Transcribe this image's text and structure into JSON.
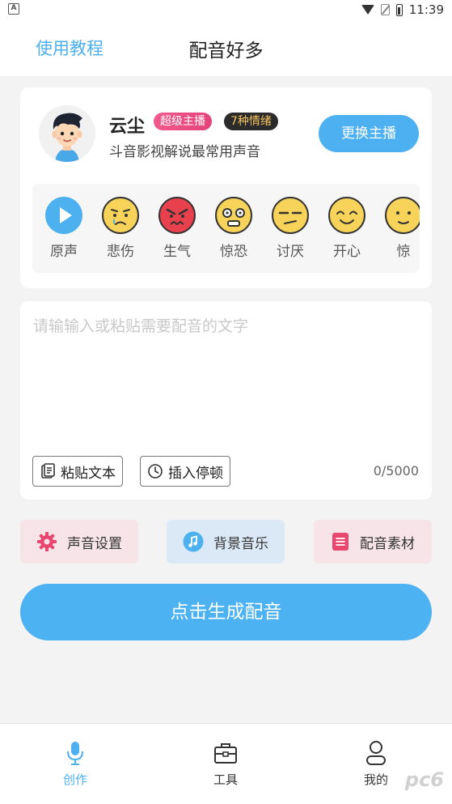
{
  "status_bar": {
    "time": "11:39",
    "left_icon": "a-icon"
  },
  "header": {
    "tutorial_link": "使用教程",
    "title": "配音好多"
  },
  "anchor": {
    "name": "云尘",
    "badge_level": "超级主播",
    "badge_emotions": "7种情绪",
    "description": "斗音影视解说最常用声音",
    "change_button": "更换主播"
  },
  "emotions": [
    {
      "label": "原声",
      "icon": "play-icon"
    },
    {
      "label": "悲伤",
      "icon": "sad-face-icon"
    },
    {
      "label": "生气",
      "icon": "angry-face-icon"
    },
    {
      "label": "惊恐",
      "icon": "shocked-face-icon"
    },
    {
      "label": "讨厌",
      "icon": "annoyed-face-icon"
    },
    {
      "label": "开心",
      "icon": "happy-face-icon"
    },
    {
      "label": "惊",
      "icon": "surprised-face-icon"
    }
  ],
  "editor": {
    "placeholder": "请输输入或粘贴需要配音的文字",
    "value": "",
    "paste_button": "粘贴文本",
    "pause_button": "插入停顿",
    "counter": "0/5000"
  },
  "options": {
    "sound_settings": "声音设置",
    "background_music": "背景音乐",
    "material": "配音素材"
  },
  "generate_button": "点击生成配音",
  "tabbar": {
    "create": "创作",
    "tools": "工具",
    "mine": "我的"
  },
  "watermark": "pc6",
  "colors": {
    "accent": "#4cb1ee",
    "pink_icon": "#e8456f",
    "blue_icon": "#4cb1ee"
  }
}
